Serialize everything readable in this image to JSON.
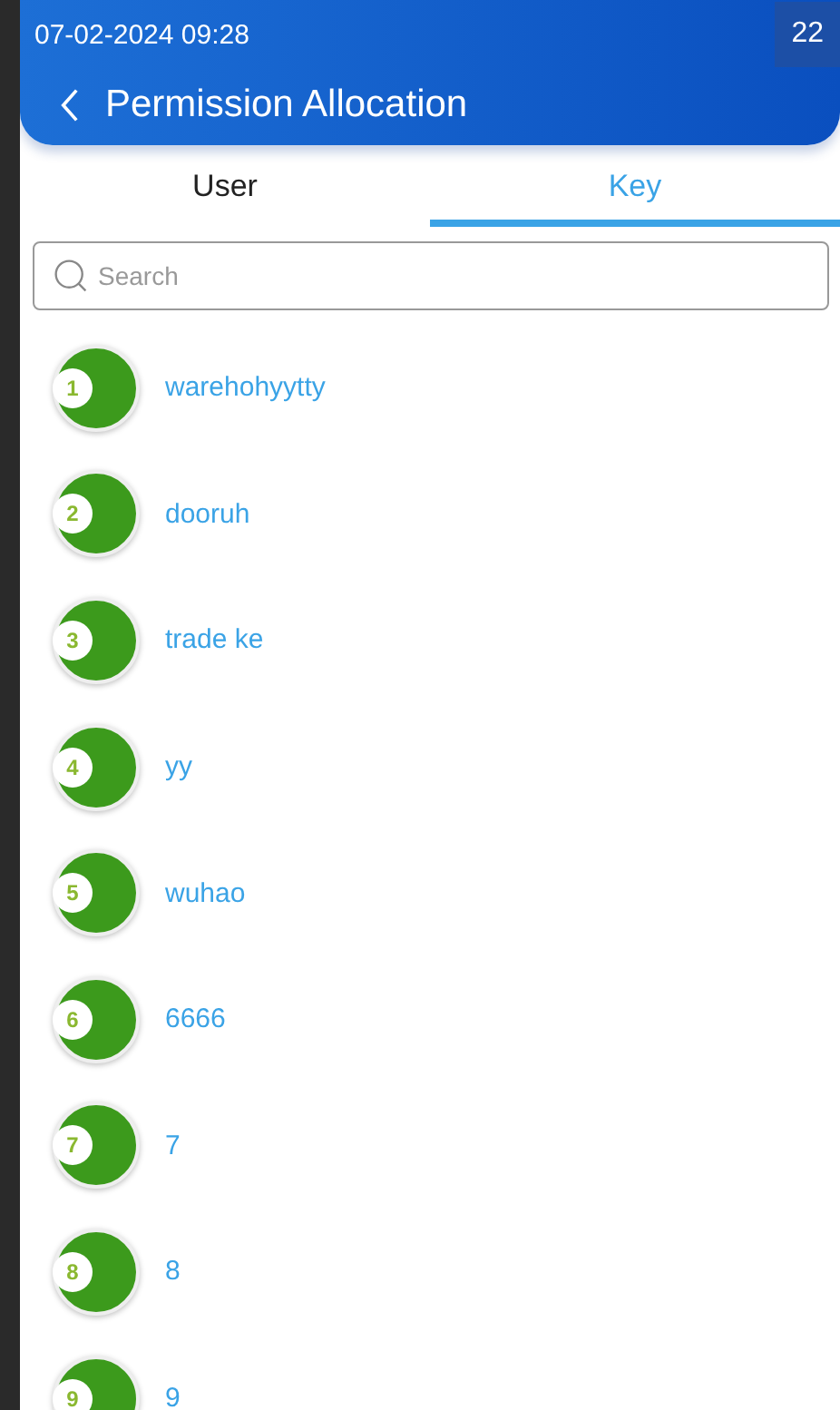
{
  "status_bar": {
    "datetime": "07-02-2024 09:28",
    "badge": "22"
  },
  "header": {
    "title": "Permission Allocation"
  },
  "tabs": [
    {
      "label": "User",
      "selected": false
    },
    {
      "label": "Key",
      "selected": true
    }
  ],
  "search": {
    "placeholder": "Search"
  },
  "items": [
    {
      "number": "1",
      "name": "warehohyytty"
    },
    {
      "number": "2",
      "name": "dooruh"
    },
    {
      "number": "3",
      "name": "trade ke"
    },
    {
      "number": "4",
      "name": "yy"
    },
    {
      "number": "5",
      "name": "wuhao"
    },
    {
      "number": "6",
      "name": "6666"
    },
    {
      "number": "7",
      "name": "7"
    },
    {
      "number": "8",
      "name": "8"
    },
    {
      "number": "9",
      "name": "9"
    }
  ]
}
